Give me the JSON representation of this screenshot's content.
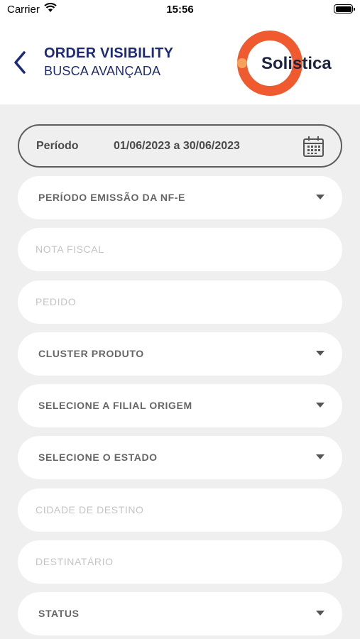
{
  "status_bar": {
    "carrier": "Carrier",
    "time": "15:56"
  },
  "header": {
    "title": "ORDER VISIBILITY",
    "subtitle": "BUSCA AVANÇADA",
    "logo_text": "Solistica",
    "colors": {
      "title": "#1d2a7a",
      "logo_ring": "#ef5a2e"
    }
  },
  "period": {
    "label": "Período",
    "value": "01/06/2023 a 30/06/2023"
  },
  "fields": [
    {
      "label": "PERÍODO EMISSÃO DA NF-E",
      "kind": "select"
    },
    {
      "placeholder": "NOTA FISCAL",
      "kind": "input"
    },
    {
      "placeholder": "PEDIDO",
      "kind": "input"
    },
    {
      "label": "CLUSTER PRODUTO",
      "kind": "select"
    },
    {
      "label": "SELECIONE A FILIAL ORIGEM",
      "kind": "select"
    },
    {
      "label": "SELECIONE O ESTADO",
      "kind": "select"
    },
    {
      "placeholder": "CIDADE DE DESTINO",
      "kind": "input"
    },
    {
      "placeholder": "DESTINATÁRIO",
      "kind": "input"
    },
    {
      "label": "STATUS",
      "kind": "select"
    }
  ]
}
